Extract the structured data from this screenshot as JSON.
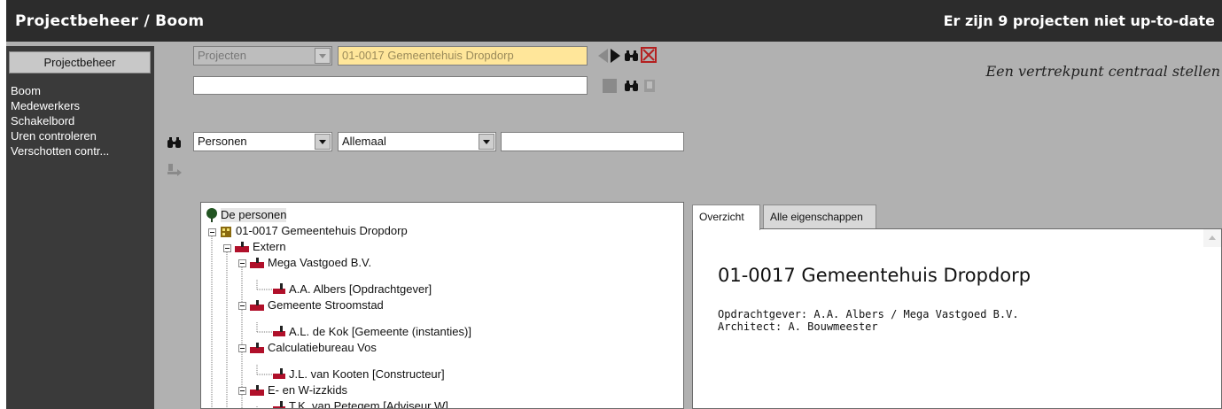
{
  "titlebar": {
    "title": "Projectbeheer / Boom",
    "status": "Er zijn 9 projecten niet up-to-date"
  },
  "sidebar": {
    "header": "Projectbeheer",
    "items": [
      "Boom",
      "Medewerkers",
      "Schakelbord",
      "Uren controleren",
      "Verschotten contr..."
    ]
  },
  "toolbar": {
    "project_type": "Projecten",
    "project_value": "01-0017 Gemeentehuis  Dropdorp",
    "second_value": "",
    "icons": [
      "prev-arrow-icon",
      "next-arrow-icon",
      "binoculars-icon",
      "close-red-icon",
      "stop-square-icon",
      "binoculars-icon",
      "bookmark-icon"
    ]
  },
  "subtitle": "Een vertrekpunt centraal stellen",
  "filters": {
    "category": "Personen",
    "scope": "Allemaal",
    "search": ""
  },
  "tree": {
    "root": "De personen",
    "nodes": [
      "01-0017 Gemeentehuis  Dropdorp",
      "Extern",
      "Mega Vastgoed B.V.",
      "A.A.  Albers [Opdrachtgever]",
      "Gemeente Stroomstad",
      "A.L. de Kok [Gemeente (instanties)]",
      "Calculatiebureau Vos",
      "J.L. van Kooten [Constructeur]",
      "E- en W-izzkids",
      "T.K. van Petegem [Adviseur W]"
    ]
  },
  "details": {
    "tabs": [
      "Overzicht",
      "Alle eigenschappen"
    ],
    "title": "01-0017 Gemeentehuis Dropdorp",
    "lines": [
      "Opdrachtgever: A.A. Albers / Mega Vastgoed B.V.",
      "Architect: A. Bouwmeester"
    ]
  },
  "colors": {
    "titlebar": "#2c2c2c",
    "sidebar": "#3a3a3a",
    "workspace": "#b1b1b1",
    "highlight_field": "#ffe69a"
  }
}
